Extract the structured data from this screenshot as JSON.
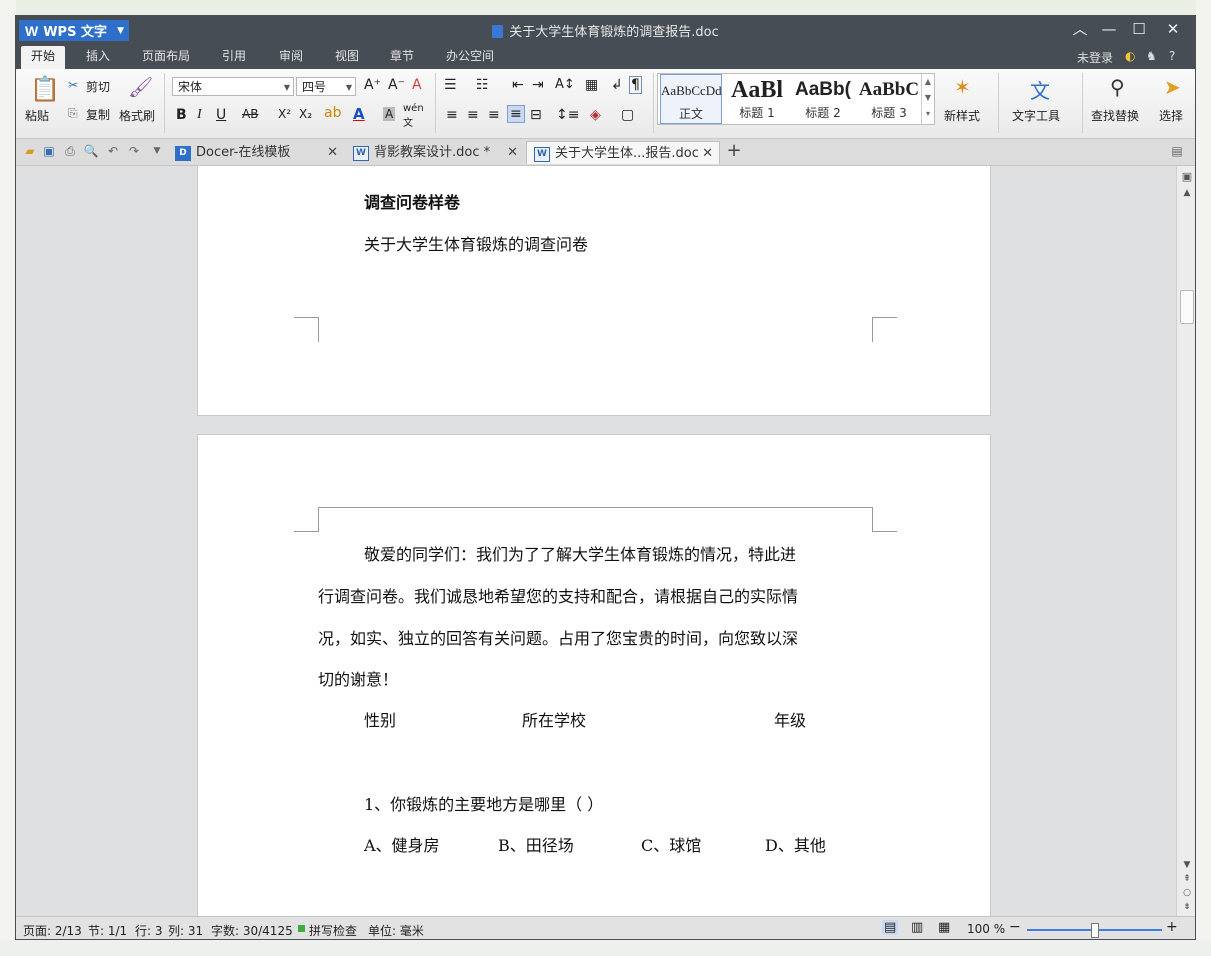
{
  "app": {
    "name": "WPS 文字",
    "title": "关于大学生体育锻炼的调查报告.doc"
  },
  "menus": [
    "开始",
    "插入",
    "页面布局",
    "引用",
    "审阅",
    "视图",
    "章节",
    "办公空间"
  ],
  "account": {
    "login": "未登录",
    "help": "?"
  },
  "ribbon": {
    "paste": "粘贴",
    "cut": "剪切",
    "copy": "复制",
    "format_painter": "格式刷",
    "font_name": "宋体",
    "font_size": "四号",
    "styles": [
      {
        "preview": "AaBbCcDd",
        "name": "正文"
      },
      {
        "preview": "AaBl",
        "name": "标题 1"
      },
      {
        "preview": "AaBb(",
        "name": "标题 2"
      },
      {
        "preview": "AaBbC",
        "name": "标题 3"
      }
    ],
    "new_style": "新样式",
    "text_tools": "文字工具",
    "find_replace": "查找替换",
    "select": "选择"
  },
  "tabs": [
    {
      "label": "Docer-在线模板",
      "active": false
    },
    {
      "label": "背影教案设计.doc *",
      "active": false
    },
    {
      "label": "关于大学生体...报告.doc",
      "active": true
    }
  ],
  "page1": {
    "heading": "调查问卷样卷",
    "subtitle": "关于大学生体育锻炼的调查问卷"
  },
  "page2": {
    "para_lines": [
      "敬爱的同学们：我们为了了解大学生体育锻炼的情况，特此进",
      "行调查问卷。我们诚恳地希望您的支持和配合，请根据自己的实际情",
      "况，如实、独立的回答有关问题。占用了您宝贵的时间，向您致以深",
      "切的谢意！"
    ],
    "info_fields": [
      "性别",
      "所在学校",
      "年级"
    ],
    "question1": "1、你锻炼的主要地方是哪里（  ）",
    "options": [
      "A、健身房",
      "B、田径场",
      "C、球馆",
      "D、其他"
    ]
  },
  "status": {
    "page": "页面: 2/13",
    "section": "节: 1/1",
    "row": "行: 3",
    "col": "列: 31",
    "words": "字数: 30/4125",
    "spell": "拼写检查",
    "unit": "单位: 毫米",
    "zoom": "100 %"
  },
  "colors": {
    "title_bar": "#474d55",
    "accent": "#2e6fc9",
    "page": "#ffffff"
  }
}
